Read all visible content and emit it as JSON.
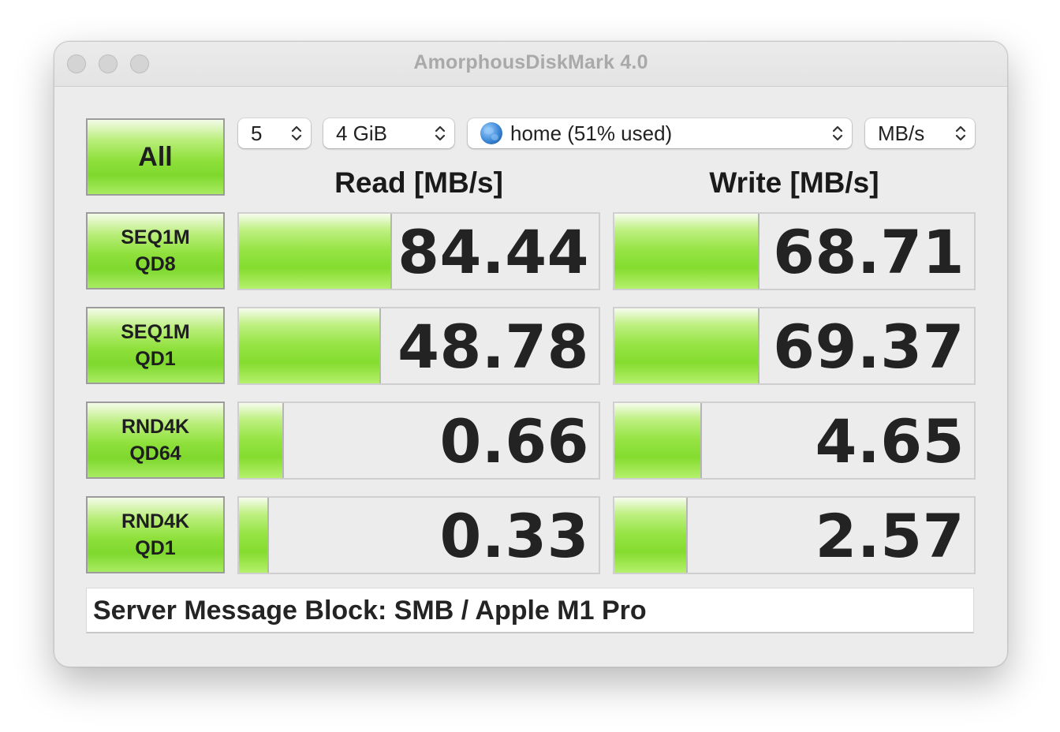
{
  "window": {
    "title": "AmorphousDiskMark 4.0"
  },
  "controls": {
    "count": "5",
    "size": "4 GiB",
    "target": "home (51% used)",
    "unit": "MB/s"
  },
  "headers": {
    "read": "Read [MB/s]",
    "write": "Write [MB/s]"
  },
  "all_button": "All",
  "rows": [
    {
      "line1": "SEQ1M",
      "line2": "QD8",
      "read": "84.44",
      "write": "68.71",
      "read_fill": 0.42,
      "write_fill": 0.4
    },
    {
      "line1": "SEQ1M",
      "line2": "QD1",
      "read": "48.78",
      "write": "69.37",
      "read_fill": 0.39,
      "write_fill": 0.4
    },
    {
      "line1": "RND4K",
      "line2": "QD64",
      "read": "0.66",
      "write": "4.65",
      "read_fill": 0.12,
      "write_fill": 0.24
    },
    {
      "line1": "RND4K",
      "line2": "QD1",
      "read": "0.33",
      "write": "2.57",
      "read_fill": 0.08,
      "write_fill": 0.2
    }
  ],
  "comment": "Server Message Block: SMB / Apple M1 Pro",
  "colors": {
    "accent_green": "#8ee03a",
    "background": "#ececec"
  },
  "icons": {
    "target": "network-globe-icon",
    "select": "up-down-chevron-icon"
  }
}
